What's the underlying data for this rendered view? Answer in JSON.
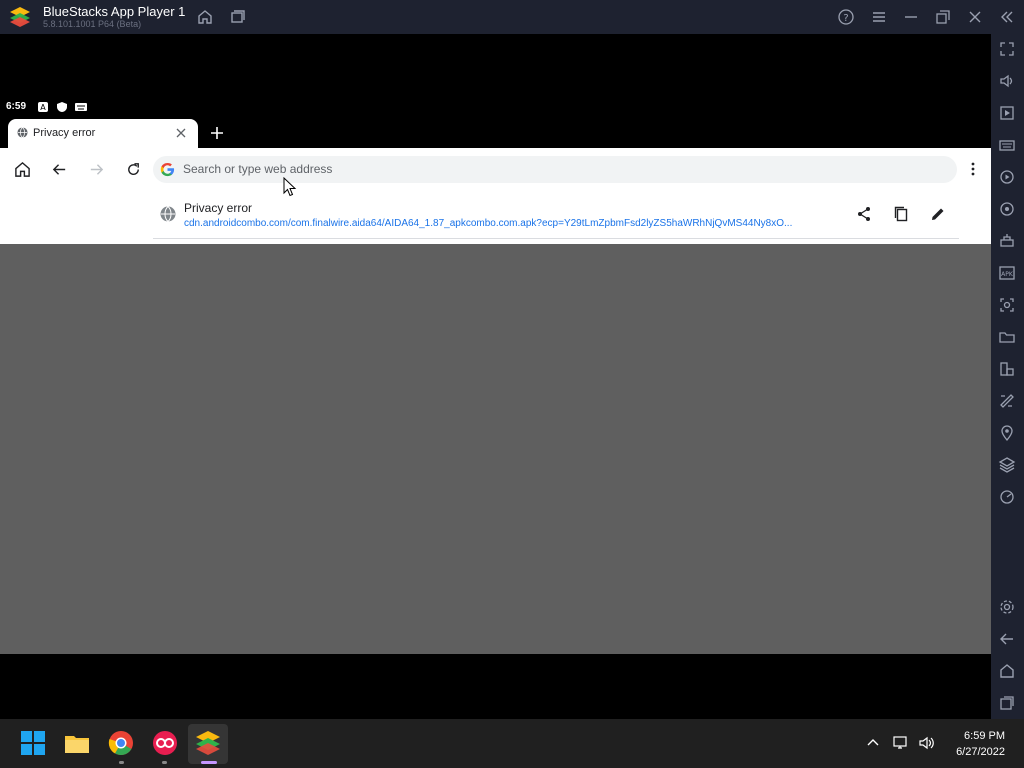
{
  "titlebar": {
    "title": "BlueStacks App Player 1",
    "version": "5.8.101.1001 P64 (Beta)"
  },
  "android": {
    "status_time": "6:59"
  },
  "chrome": {
    "tab_title": "Privacy error",
    "omnibox_placeholder": "Search or type web address",
    "suggestion": {
      "title": "Privacy error",
      "url": "cdn.androidcombo.com/com.finalwire.aida64/AIDA64_1.87_apkcombo.com.apk?ecp=Y29tLmZpbmFsd2lyZS5haWRhNjQvMS44Ny8xO..."
    }
  },
  "taskbar": {
    "time": "6:59 PM",
    "date": "6/27/2022"
  },
  "colors": {
    "titlebar_bg": "#1e2230",
    "taskbar_bg": "#202020",
    "page_bg": "#5f5f5f",
    "link_blue": "#1a73e8"
  }
}
